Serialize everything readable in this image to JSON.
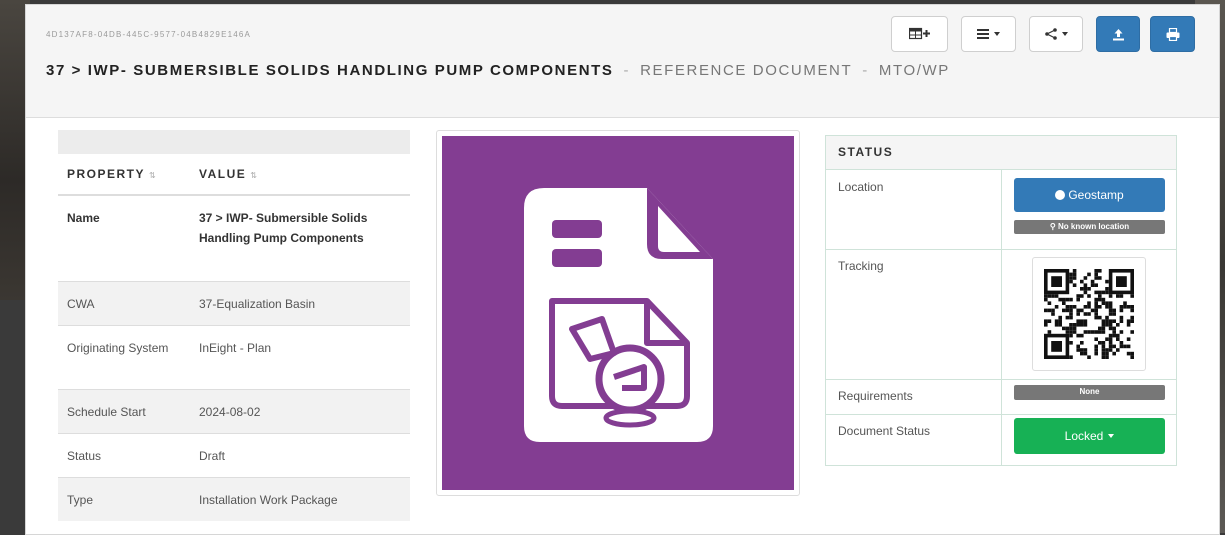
{
  "header": {
    "guid": "4D137AF8-04DB-445C-9577-04B4829E146A",
    "title_main": "37 > IWP- SUBMERSIBLE SOLIDS HANDLING PUMP COMPONENTS",
    "separator": "-",
    "title_type": "REFERENCE DOCUMENT",
    "title_category": "MTO/WP"
  },
  "toolbar": {
    "buttons": [
      {
        "icon": "table-add-icon"
      },
      {
        "icon": "list-menu-icon"
      },
      {
        "icon": "share-icon"
      },
      {
        "icon": "upload-icon"
      },
      {
        "icon": "print-icon"
      }
    ]
  },
  "properties": {
    "col_property": "PROPERTY",
    "col_value": "VALUE",
    "rows": [
      {
        "key": "Name",
        "value": "37 > IWP- Submersible Solids Handling Pump Components"
      },
      {
        "key": "CWA",
        "value": "37-Equalization Basin"
      },
      {
        "key": "Originating System",
        "value": "InEight - Plan"
      },
      {
        "key": "Schedule Start",
        "value": "2024-08-02"
      },
      {
        "key": "Status",
        "value": "Draft"
      },
      {
        "key": "Type",
        "value": "Installation Work Package"
      }
    ]
  },
  "thumbnail": {
    "icon": "document-pump-icon",
    "background_color": "#833d92"
  },
  "status_panel": {
    "title": "STATUS",
    "location_label": "Location",
    "geostamp_button": "Geostamp",
    "no_location": "No known location",
    "tracking_label": "Tracking",
    "requirements_label": "Requirements",
    "requirements_value": "None",
    "document_status_label": "Document Status",
    "document_status_value": "Locked"
  },
  "colors": {
    "primary": "#337ab7",
    "success": "#17b155",
    "muted_label": "#777777"
  }
}
